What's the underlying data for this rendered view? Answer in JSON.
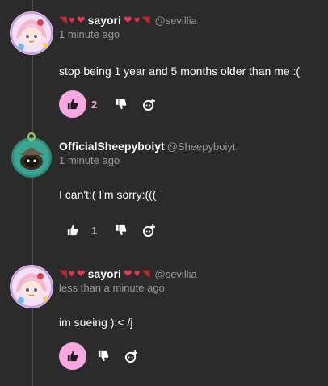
{
  "colors": {
    "background": "#2b2b2b",
    "accent_pink": "#f7a8e3",
    "muted_text": "#9a9a9a",
    "thread_line": "#4d4d4d"
  },
  "comments": [
    {
      "display_name": "sayori",
      "name_decorations": [
        "boot-emoji",
        "sparkle-heart-emoji",
        "heart-emoji"
      ],
      "name_decorations_after": [
        "heart-emoji",
        "sparkle-heart-emoji",
        "boot-emoji"
      ],
      "handle": "@sevillia",
      "time": "1 minute ago",
      "text": "stop being 1 year and 5 months older than me :(",
      "likes": "2",
      "liked": true,
      "avatar_icon": "anime-girl-avatar"
    },
    {
      "display_name": "OfficialSheepyboiyt",
      "handle": "@Sheepyboiyt",
      "time": "1 minute ago",
      "text": "I can't:( I'm sorry:(((",
      "likes": "1",
      "liked": false,
      "avatar_icon": "sheep-avatar"
    },
    {
      "display_name": "sayori",
      "name_decorations": [
        "boot-emoji",
        "sparkle-heart-emoji",
        "heart-emoji"
      ],
      "name_decorations_after": [
        "heart-emoji",
        "sparkle-heart-emoji",
        "boot-emoji"
      ],
      "handle": "@sevillia",
      "time": "less than a minute ago",
      "text": "im sueing ):< /j",
      "likes": "",
      "liked": true,
      "avatar_icon": "anime-girl-avatar"
    }
  ],
  "icons": {
    "like": "thumbs-up-icon",
    "dislike": "thumbs-down-icon",
    "reply": "add-reply-icon"
  }
}
